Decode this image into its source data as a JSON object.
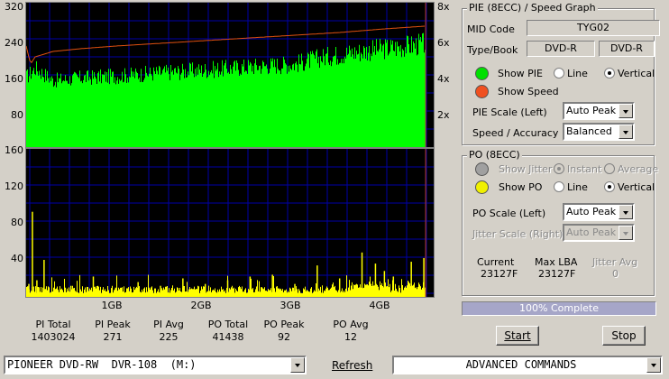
{
  "top_chart": {
    "y_ticks": [
      "320",
      "240",
      "160",
      "80"
    ],
    "speed_ticks": [
      "8x",
      "6x",
      "4x",
      "2x"
    ]
  },
  "bottom_chart": {
    "y_ticks": [
      "160",
      "120",
      "80",
      "40"
    ],
    "x_ticks": [
      "1GB",
      "2GB",
      "3GB",
      "4GB"
    ]
  },
  "chart_data": [
    {
      "type": "area",
      "title": "",
      "series": [
        {
          "name": "PIE (8ECC)",
          "color": "#00ff00",
          "x": [
            0.0,
            0.1,
            0.3,
            0.6,
            1.0,
            1.5,
            2.0,
            2.5,
            3.0,
            3.3,
            3.6,
            4.0,
            4.3,
            4.45
          ],
          "values": [
            160,
            180,
            152,
            158,
            162,
            170,
            176,
            184,
            190,
            205,
            215,
            225,
            232,
            236
          ]
        },
        {
          "name": "Speed",
          "color": "#e05010",
          "x": [
            0.0,
            0.05,
            0.1,
            0.3,
            0.6,
            1.0,
            1.5,
            2.0,
            2.5,
            3.0,
            3.5,
            4.0,
            4.45
          ],
          "values": [
            5.6,
            4.6,
            5.0,
            5.3,
            5.45,
            5.6,
            5.75,
            5.9,
            6.05,
            6.2,
            6.35,
            6.55,
            6.7
          ]
        }
      ],
      "xlim": [
        0,
        4.55
      ],
      "ylim": [
        0,
        320
      ],
      "y2lim": [
        0,
        8
      ]
    },
    {
      "type": "bar",
      "title": "",
      "series": [
        {
          "name": "PO (8ECC)",
          "color": "#ffff00",
          "x": [
            0.03,
            0.07,
            0.12,
            0.2,
            0.35,
            0.5,
            0.75,
            1.0,
            1.25,
            1.5,
            1.75,
            2.0,
            2.25,
            2.5,
            2.75,
            3.0,
            3.25,
            3.5,
            3.75,
            3.9,
            4.0,
            4.1,
            4.3,
            4.44
          ],
          "values": [
            14,
            92,
            18,
            40,
            8,
            12,
            22,
            10,
            16,
            12,
            20,
            14,
            18,
            22,
            24,
            14,
            34,
            20,
            48,
            36,
            28,
            22,
            38,
            42
          ]
        },
        {
          "name": "Jitter",
          "color": "#000000",
          "x": [],
          "values": []
        }
      ],
      "xlim": [
        0,
        4.55
      ],
      "ylim": [
        0,
        160
      ]
    }
  ],
  "stats": {
    "pi_total_label": "PI Total",
    "pi_total": "1403024",
    "pi_peak_label": "PI Peak",
    "pi_peak": "271",
    "pi_avg_label": "PI Avg",
    "pi_avg": "225",
    "po_total_label": "PO Total",
    "po_total": "41438",
    "po_peak_label": "PO Peak",
    "po_peak": "92",
    "po_avg_label": "PO Avg",
    "po_avg": "12"
  },
  "pie_group": {
    "title": "PIE (8ECC) / Speed Graph",
    "mid_code_label": "MID Code",
    "mid_code_value": "TYG02",
    "type_book_label": "Type/Book",
    "type_value": "DVD-R",
    "book_value": "DVD-R",
    "show_pie_label": "Show PIE",
    "line_label": "Line",
    "vertical_label": "Vertical",
    "show_speed_label": "Show Speed",
    "pie_scale_label": "PIE Scale (Left)",
    "pie_scale_value": "Auto Peak",
    "speed_accuracy_label": "Speed / Accuracy",
    "speed_accuracy_value": "Balanced",
    "pie_color": "#00e000",
    "speed_color": "#f05020"
  },
  "po_group": {
    "title": "PO (8ECC)",
    "show_jitter_label": "Show Jitter",
    "instant_label": "Instant",
    "average_label": "Average",
    "show_po_label": "Show PO",
    "line_label": "Line",
    "vertical_label": "Vertical",
    "po_scale_label": "PO Scale (Left)",
    "po_scale_value": "Auto Peak",
    "jitter_scale_label": "Jitter Scale (Right)",
    "jitter_scale_value": "Auto Peak",
    "current_label": "Current",
    "current_value": "23127F",
    "max_lba_label": "Max LBA",
    "max_lba_value": "23127F",
    "jitter_avg_label": "Jitter Avg",
    "jitter_avg_value": "0",
    "po_color": "#f0f000",
    "jitter_color": "#a0a0a0"
  },
  "progress": {
    "text": "100% Complete",
    "fraction": 1.0
  },
  "buttons": {
    "start_label": "Start",
    "stop_label": "Stop",
    "refresh_label": "Refresh"
  },
  "bottom_bar": {
    "drive_value": "PIONEER DVD-RW  DVR-108  (M:)",
    "commands_value": "ADVANCED COMMANDS"
  }
}
